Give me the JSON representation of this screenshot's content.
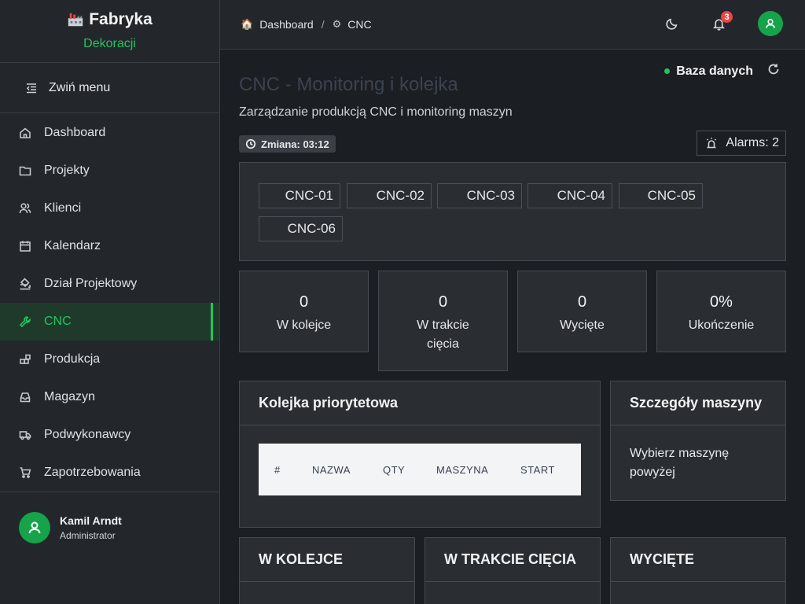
{
  "brand": {
    "title": "Fabryka",
    "subtitle": "Dekoracji"
  },
  "sidebar": {
    "collapse_label": "Zwiń menu",
    "items": [
      {
        "label": "Dashboard",
        "icon": "home-icon"
      },
      {
        "label": "Projekty",
        "icon": "folder-icon"
      },
      {
        "label": "Klienci",
        "icon": "users-icon"
      },
      {
        "label": "Kalendarz",
        "icon": "calendar-icon"
      },
      {
        "label": "Dział Projektowy",
        "icon": "paint-bucket-icon"
      },
      {
        "label": "CNC",
        "icon": "wrench-icon",
        "active": true
      },
      {
        "label": "Produkcja",
        "icon": "blocks-icon"
      },
      {
        "label": "Magazyn",
        "icon": "inbox-icon"
      },
      {
        "label": "Podwykonawcy",
        "icon": "truck-icon"
      },
      {
        "label": "Zapotrzebowania",
        "icon": "cart-icon"
      }
    ],
    "user": {
      "name": "Kamil Arndt",
      "role": "Administrator"
    }
  },
  "header": {
    "breadcrumb": [
      "Dashboard",
      "CNC"
    ],
    "separator": "/",
    "notifications_count": "3"
  },
  "main": {
    "db_status": "Baza danych",
    "title": "CNC - Monitoring i kolejka",
    "subtitle": "Zarządzanie produkcją CNC i monitoring maszyn",
    "shift": "Zmiana: 03:12",
    "alarms": "Alarms: 2",
    "machines": [
      "CNC-01",
      "CNC-02",
      "CNC-03",
      "CNC-04",
      "CNC-05",
      "CNC-06"
    ],
    "stats": [
      {
        "value": "0",
        "label": "W kolejce"
      },
      {
        "value": "0",
        "label": "W trakcie cięcia"
      },
      {
        "value": "0",
        "label": "Wycięte"
      },
      {
        "value": "0%",
        "label": "Ukończenie"
      }
    ],
    "queue": {
      "title": "Kolejka priorytetowa",
      "columns": [
        "#",
        "NAZWA",
        "QTY",
        "MASZYNA",
        "START"
      ]
    },
    "details": {
      "title": "Szczegóły maszyny",
      "placeholder": "Wybierz maszynę powyżej"
    },
    "kanban": [
      "W KOLEJCE",
      "W TRAKCIE CIĘCIA",
      "WYCIĘTE"
    ]
  },
  "colors": {
    "accent": "#22c55e",
    "badge": "#ef4444",
    "background": "#1b1e22",
    "panel": "#2a2e33"
  }
}
